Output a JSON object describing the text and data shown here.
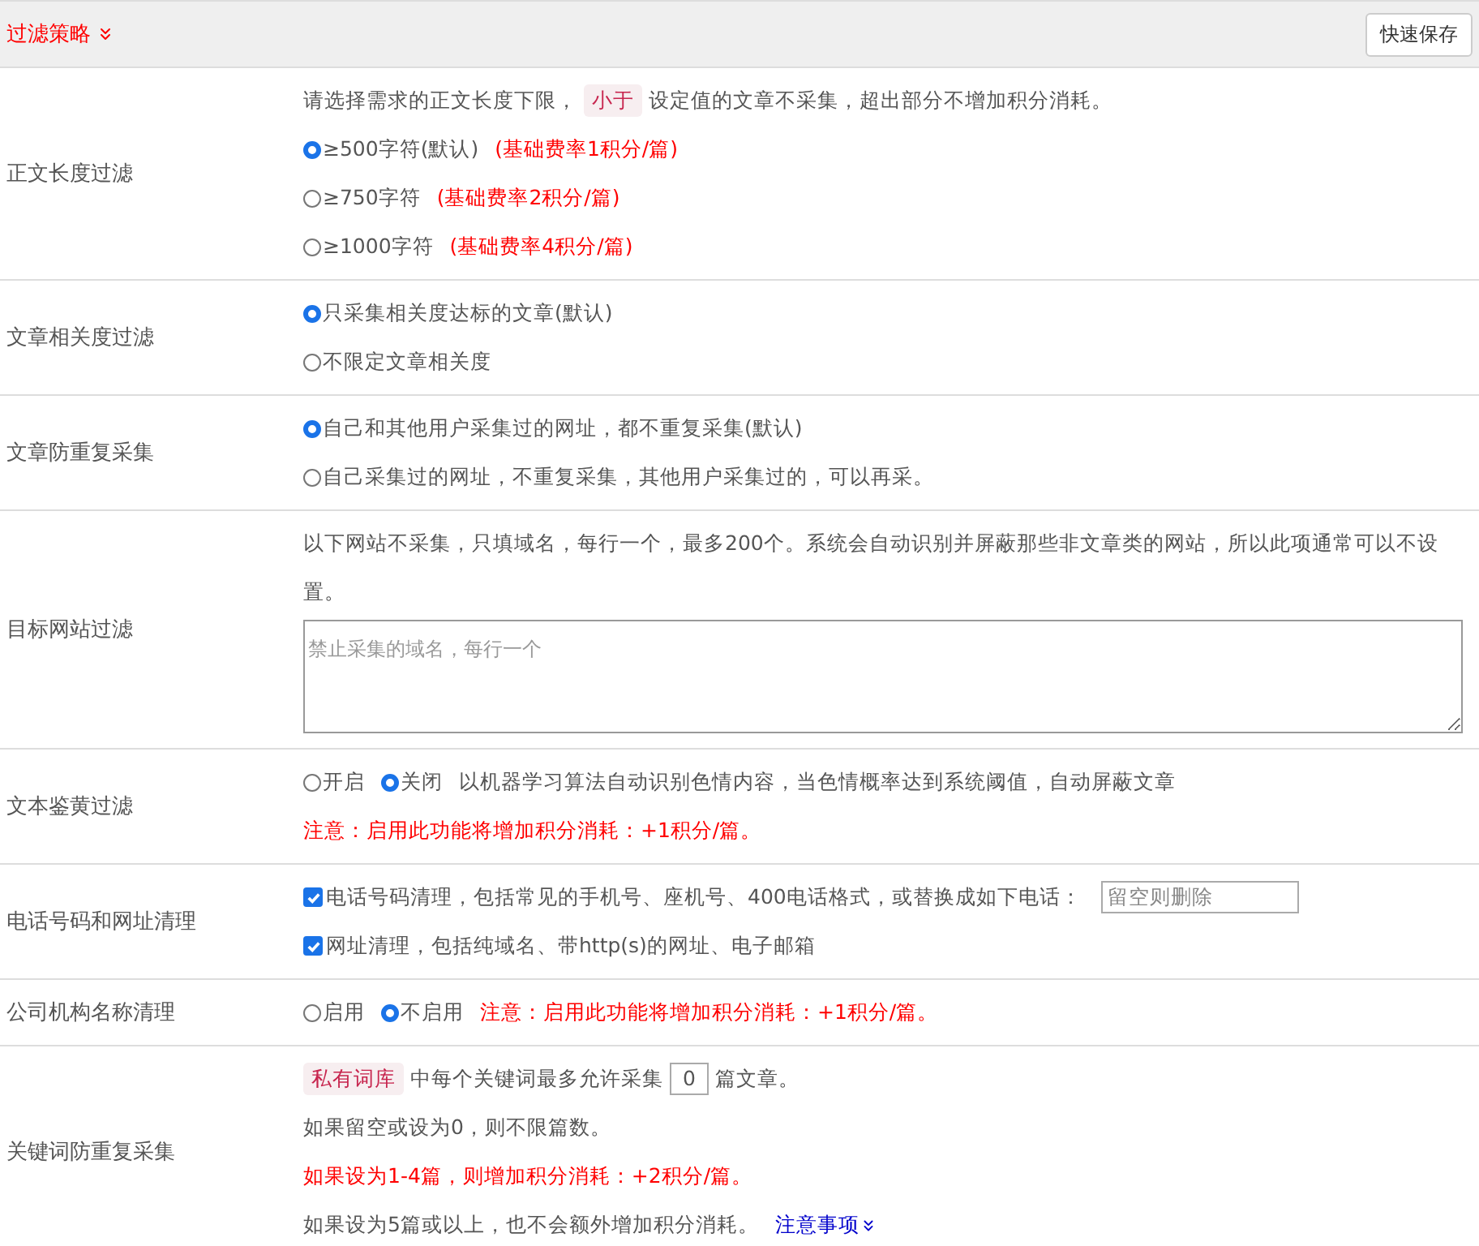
{
  "header": {
    "title": "过滤策略",
    "button": "快速保存"
  },
  "rows": [
    {
      "label": "正文长度过滤",
      "lines": [
        {
          "parts": [
            {
              "kind": "text",
              "text": "请选择需求的正文长度下限，"
            },
            {
              "kind": "tag",
              "text": "小于"
            },
            {
              "kind": "text",
              "text": "设定值的文章不采集，超出部分不增加积分消耗。"
            }
          ]
        },
        {
          "parts": [
            {
              "kind": "radio",
              "label": "≥500字符(默认)",
              "selected": true
            },
            {
              "kind": "warn",
              "text": "(基础费率1积分/篇)"
            }
          ]
        },
        {
          "parts": [
            {
              "kind": "radio",
              "label": "≥750字符",
              "selected": false
            },
            {
              "kind": "warn",
              "text": "(基础费率2积分/篇)"
            }
          ]
        },
        {
          "parts": [
            {
              "kind": "radio",
              "label": "≥1000字符",
              "selected": false
            },
            {
              "kind": "warn",
              "text": "(基础费率4积分/篇)"
            }
          ]
        }
      ]
    },
    {
      "label": "文章相关度过滤",
      "lines": [
        {
          "parts": [
            {
              "kind": "radio",
              "label": "只采集相关度达标的文章(默认)",
              "selected": true
            }
          ]
        },
        {
          "parts": [
            {
              "kind": "radio",
              "label": "不限定文章相关度",
              "selected": false
            }
          ]
        }
      ]
    },
    {
      "label": "文章防重复采集",
      "lines": [
        {
          "parts": [
            {
              "kind": "radio",
              "label": "自己和其他用户采集过的网址，都不重复采集(默认)",
              "selected": true
            }
          ]
        },
        {
          "parts": [
            {
              "kind": "radio",
              "label": "自己采集过的网址，不重复采集，其他用户采集过的，可以再采。",
              "selected": false
            }
          ]
        }
      ]
    },
    {
      "label": "目标网站过滤",
      "lines": [
        {
          "parts": [
            {
              "kind": "text",
              "text": "以下网站不采集，只填域名，每行一个，最多200个。系统会自动识别并屏蔽那些非文章类的网站，所以此项通常可以不设置。"
            }
          ]
        },
        {
          "parts": [
            {
              "kind": "textarea",
              "placeholder": "禁止采集的域名，每行一个"
            }
          ]
        }
      ]
    },
    {
      "label": "文本鉴黄过滤",
      "lines": [
        {
          "parts": [
            {
              "kind": "radio",
              "label": "开启",
              "selected": false
            },
            {
              "kind": "radio",
              "label": "关闭",
              "selected": true
            },
            {
              "kind": "text",
              "text": "以机器学习算法自动识别色情内容，当色情概率达到系统阈值，自动屏蔽文章"
            }
          ]
        },
        {
          "parts": [
            {
              "kind": "warn",
              "text": "注意：启用此功能将增加积分消耗：+1积分/篇。"
            }
          ]
        }
      ]
    },
    {
      "label": "电话号码和网址清理",
      "lines": [
        {
          "parts": [
            {
              "kind": "check",
              "label": "电话号码清理，包括常见的手机号、座机号、400电话格式，或替换成如下电话：",
              "checked": true
            },
            {
              "kind": "input",
              "placeholder": "留空则删除"
            }
          ]
        },
        {
          "parts": [
            {
              "kind": "check",
              "label": "网址清理，包括纯域名、带http(s)的网址、电子邮箱",
              "checked": true
            }
          ]
        }
      ]
    },
    {
      "label": "公司机构名称清理",
      "lines": [
        {
          "parts": [
            {
              "kind": "radio",
              "label": "启用",
              "selected": false
            },
            {
              "kind": "radio",
              "label": "不启用",
              "selected": true
            },
            {
              "kind": "warn",
              "text": "注意：启用此功能将增加积分消耗：+1积分/篇。"
            }
          ]
        }
      ]
    },
    {
      "label": "关键词防重复采集",
      "lines": [
        {
          "parts": [
            {
              "kind": "tag",
              "text": "私有词库"
            },
            {
              "kind": "text",
              "text": "中每个关键词最多允许采集"
            },
            {
              "kind": "number",
              "value": "0"
            },
            {
              "kind": "text",
              "text": "篇文章。"
            }
          ]
        },
        {
          "parts": [
            {
              "kind": "text",
              "text": "如果留空或设为0，则不限篇数。"
            }
          ]
        },
        {
          "parts": [
            {
              "kind": "warn",
              "text": "如果设为1-4篇，则增加积分消耗：+2积分/篇。"
            }
          ]
        },
        {
          "parts": [
            {
              "kind": "text",
              "text": "如果设为5篇或以上，也不会额外增加积分消耗。"
            },
            {
              "kind": "link",
              "text": "注意事项"
            }
          ]
        }
      ]
    }
  ]
}
